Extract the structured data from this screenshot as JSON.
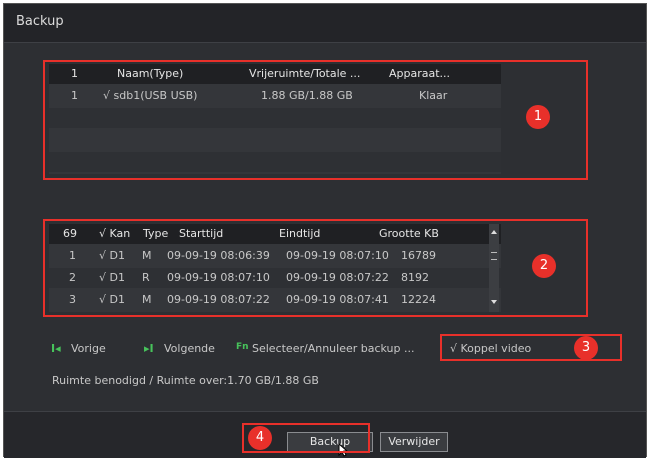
{
  "window": {
    "title": "Backup"
  },
  "devices": {
    "headers": [
      "1",
      "Naam(Type)",
      "Vrijeruimte/Totale ...",
      "Apparaat..."
    ],
    "rows": [
      {
        "num": "1",
        "name": "√ sdb1(USB USB)",
        "space": "1.88 GB/1.88 GB",
        "status": "Klaar"
      }
    ]
  },
  "files": {
    "headers": {
      "count": "69",
      "kan": "√ Kan",
      "type": "Type",
      "start": "Starttijd",
      "end": "Eindtijd",
      "size": "Grootte KB"
    },
    "rows": [
      {
        "num": "1",
        "kan": "√ D1",
        "type": "M",
        "start": "09-09-19 08:06:39",
        "end": "09-09-19 08:07:10",
        "size": "16789"
      },
      {
        "num": "2",
        "kan": "√ D1",
        "type": "R",
        "start": "09-09-19 08:07:10",
        "end": "09-09-19 08:07:22",
        "size": "8192"
      },
      {
        "num": "3",
        "kan": "√ D1",
        "type": "M",
        "start": "09-09-19 08:07:22",
        "end": "09-09-19 08:07:41",
        "size": "12224"
      }
    ]
  },
  "nav": {
    "prev_key": "I◂",
    "prev": "Vorige",
    "next_key": "▸I",
    "next": "Volgende",
    "fn_key": "Fn",
    "select": "Selecteer/Annuleer backup ...",
    "attach": "√ Koppel video"
  },
  "space_info": "Ruimte benodigd / Ruimte over:1.70 GB/1.88 GB",
  "buttons": {
    "backup": "Backup",
    "delete": "Verwijder"
  },
  "badges": [
    "1",
    "2",
    "3",
    "4"
  ],
  "colors": {
    "highlight": "#e8302a",
    "accent": "#47c35b"
  }
}
